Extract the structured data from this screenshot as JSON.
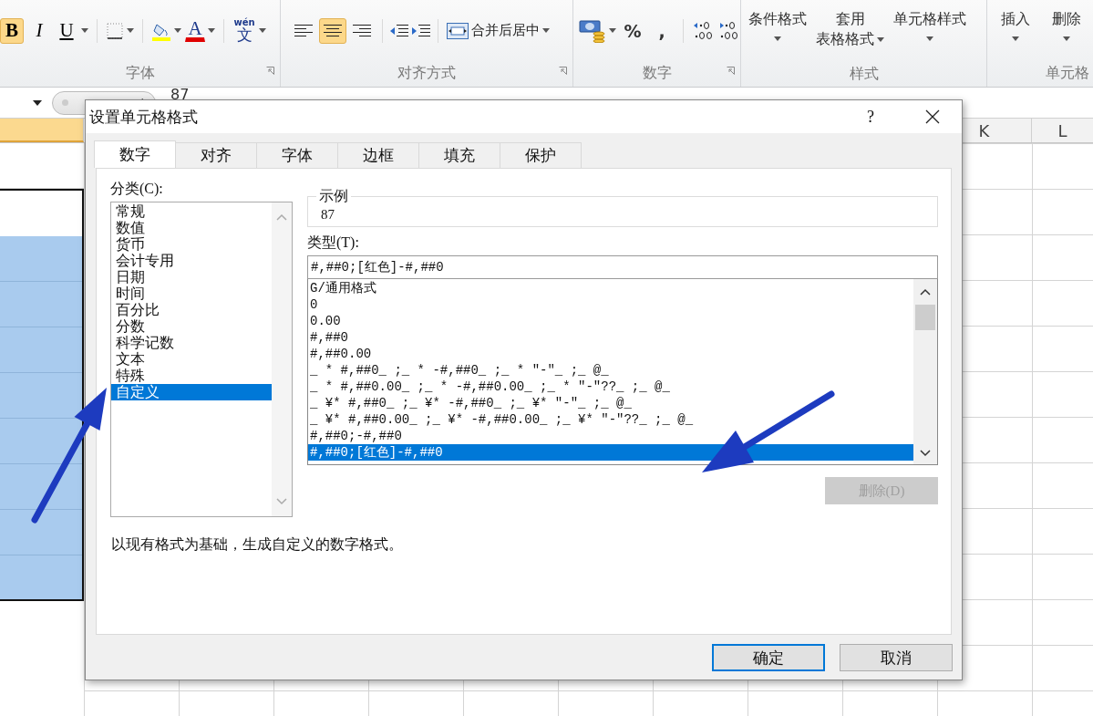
{
  "ribbon": {
    "font": {
      "label": "字体",
      "launcher": true,
      "style_buttons": [
        {
          "label": "B",
          "kind": "bold",
          "selected": true
        },
        {
          "label": "I",
          "kind": "italic",
          "selected": false
        },
        {
          "label": "U",
          "kind": "underline",
          "selected": false
        }
      ],
      "font_color": "A",
      "phonetic": {
        "ruby": "wén",
        "glyph": "文"
      }
    },
    "align": {
      "label": "对齐方式",
      "launcher": true,
      "buttons": [
        {
          "kind": "left",
          "selected": false
        },
        {
          "kind": "center",
          "selected": true
        },
        {
          "kind": "right",
          "selected": false
        }
      ],
      "merge": "合并后居中"
    },
    "number": {
      "label": "数字",
      "launcher": true,
      "symbols": [
        "%",
        ","
      ]
    },
    "styles": {
      "label": "样式",
      "buttons": [
        {
          "lines": [
            "条件格式"
          ]
        },
        {
          "lines": [
            "套用",
            "表格格式"
          ]
        },
        {
          "lines": [
            "单元格样式"
          ]
        }
      ]
    },
    "cells": {
      "label": "单元格",
      "buttons": [
        "插入",
        "删除"
      ]
    }
  },
  "formula_bar": {
    "value": "87"
  },
  "sheet": {
    "columns": [
      {
        "selected": true
      },
      {
        "label": "K",
        "selected": false
      },
      {
        "label": "L",
        "selected": false
      }
    ]
  },
  "dialog": {
    "title": "设置单元格格式",
    "help": "?",
    "tabs": [
      {
        "label": "数字",
        "selected": true
      },
      {
        "label": "对齐",
        "selected": false
      },
      {
        "label": "字体",
        "selected": false
      },
      {
        "label": "边框",
        "selected": false
      },
      {
        "label": "填充",
        "selected": false
      },
      {
        "label": "保护",
        "selected": false
      }
    ],
    "category": {
      "label": "分类(C):",
      "items": [
        {
          "label": "常规",
          "selected": false
        },
        {
          "label": "数值",
          "selected": false
        },
        {
          "label": "货币",
          "selected": false
        },
        {
          "label": "会计专用",
          "selected": false
        },
        {
          "label": "日期",
          "selected": false
        },
        {
          "label": "时间",
          "selected": false
        },
        {
          "label": "百分比",
          "selected": false
        },
        {
          "label": "分数",
          "selected": false
        },
        {
          "label": "科学记数",
          "selected": false
        },
        {
          "label": "文本",
          "selected": false
        },
        {
          "label": "特殊",
          "selected": false
        },
        {
          "label": "自定义",
          "selected": true
        }
      ]
    },
    "sample": {
      "legend": "示例",
      "value": "87"
    },
    "type": {
      "label": "类型(T):",
      "value": "#,##0;[红色]-#,##0",
      "items": [
        {
          "label": "G/通用格式",
          "selected": false
        },
        {
          "label": "0",
          "selected": false
        },
        {
          "label": "0.00",
          "selected": false
        },
        {
          "label": "#,##0",
          "selected": false
        },
        {
          "label": "#,##0.00",
          "selected": false
        },
        {
          "label": "_ * #,##0_ ;_ * -#,##0_ ;_ * \"-\"_ ;_ @_",
          "selected": false
        },
        {
          "label": "_ * #,##0.00_ ;_ * -#,##0.00_ ;_ * \"-\"??_ ;_ @_",
          "selected": false
        },
        {
          "label": "_ ¥* #,##0_ ;_ ¥* -#,##0_ ;_ ¥* \"-\"_ ;_ @_",
          "selected": false
        },
        {
          "label": "_ ¥* #,##0.00_ ;_ ¥* -#,##0.00_ ;_ ¥* \"-\"??_ ;_ @_",
          "selected": false
        },
        {
          "label": "#,##0;-#,##0",
          "selected": false
        },
        {
          "label": "#,##0;[红色]-#,##0",
          "selected": true
        }
      ]
    },
    "delete_button": {
      "label": "删除(D)",
      "disabled": true
    },
    "description": "以现有格式为基础，生成自定义的数字格式。",
    "buttons": [
      {
        "label": "确定",
        "default": true
      },
      {
        "label": "取消",
        "default": false
      }
    ]
  }
}
